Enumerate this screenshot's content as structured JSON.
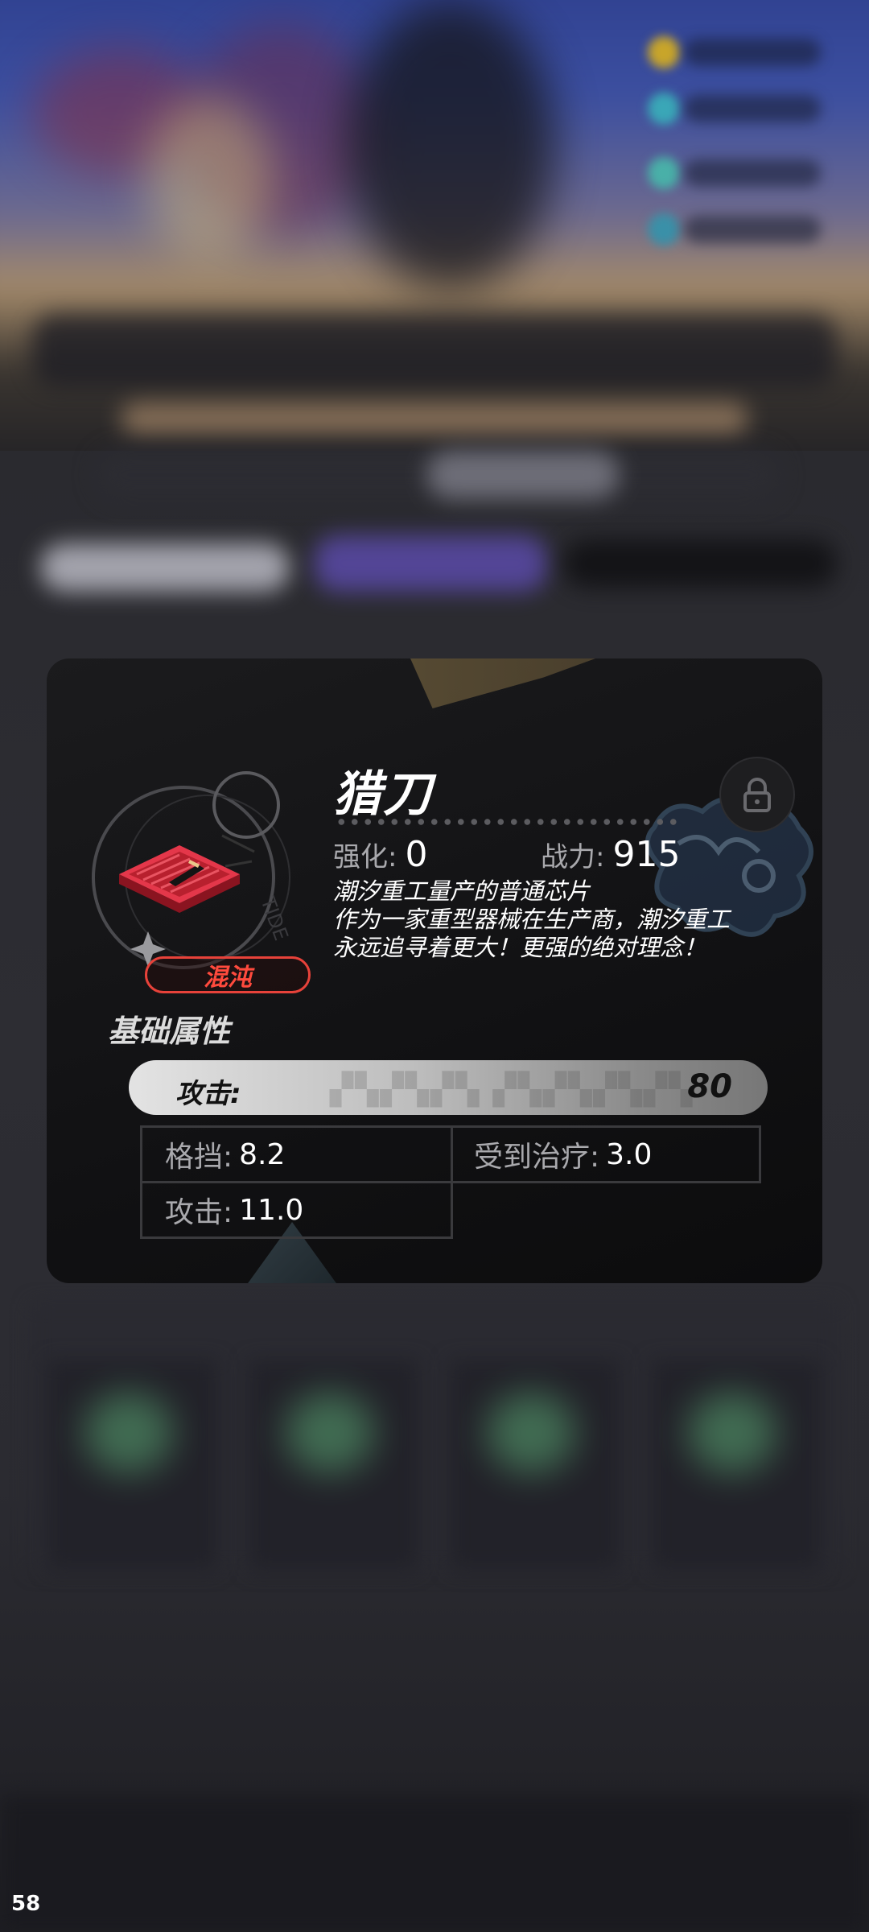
{
  "item": {
    "name": "猎刀",
    "rarity": "混沌",
    "enhance_label": "强化:",
    "enhance_value": "0",
    "power_label": "战力:",
    "power_value": "915",
    "description": [
      "潮汐重工量产的普通芯片",
      "作为一家重型器械在生产商，潮汐重工",
      "永远追寻着更大！更强的绝对理念！"
    ],
    "lock_icon": "lock-icon"
  },
  "base_attributes": {
    "title": "基础属性",
    "main_stat": {
      "label": "攻击:",
      "value": "80"
    },
    "sub_stats": [
      {
        "label": "格挡:",
        "value": "8.2"
      },
      {
        "label": "受到治疗:",
        "value": "3.0"
      },
      {
        "label": "攻击:",
        "value": "11.0"
      }
    ]
  },
  "colors": {
    "rarity_accent": "#e7423a",
    "card_bg": "#111113"
  },
  "fps": "58"
}
